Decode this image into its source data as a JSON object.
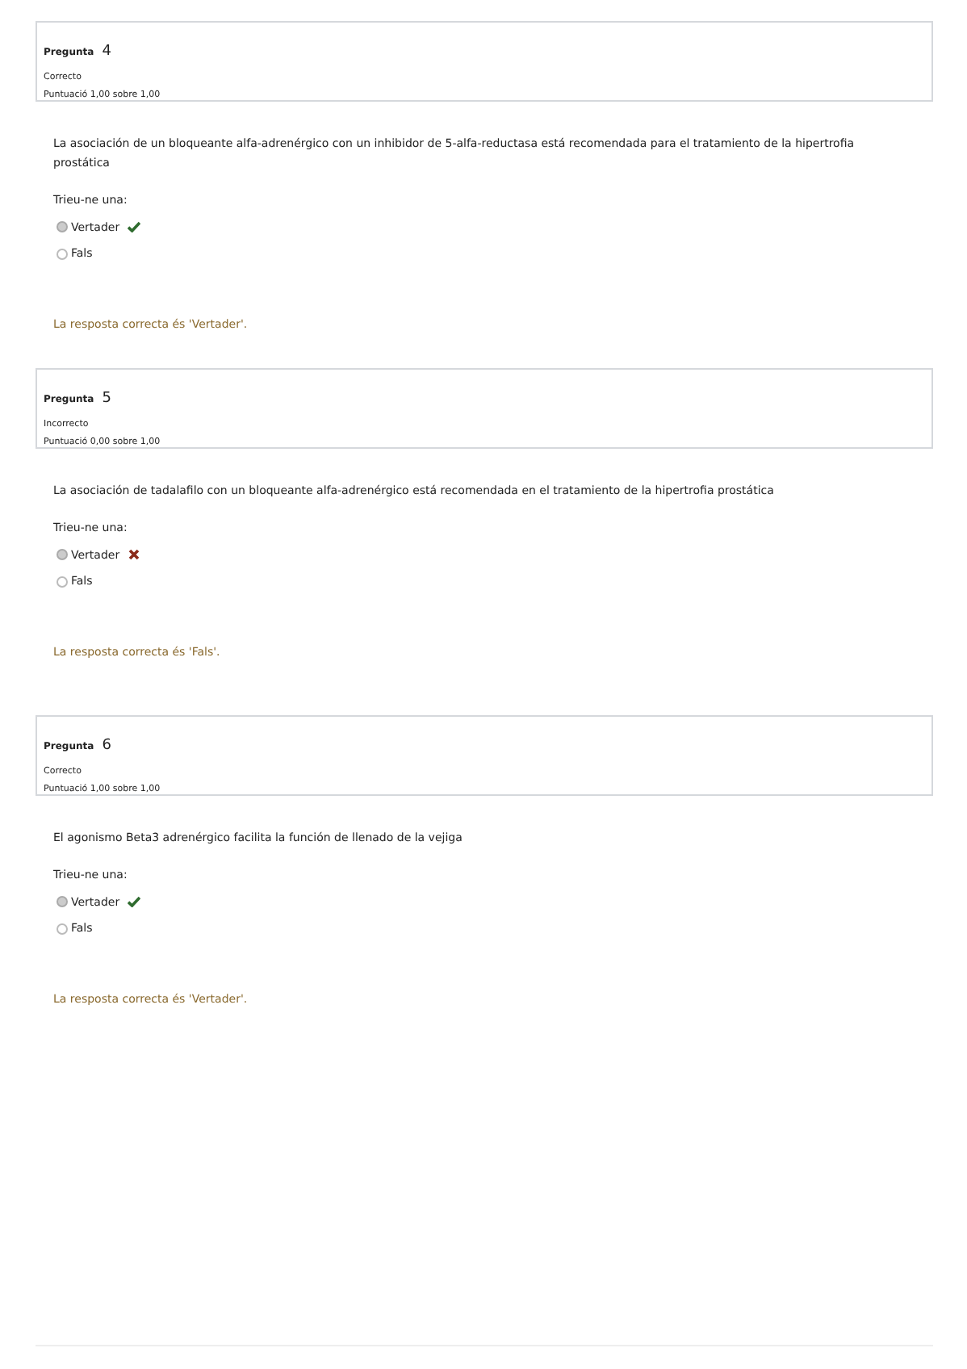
{
  "questions": [
    {
      "label": "Pregunta",
      "number": "4",
      "status": "Correcto",
      "score": "Puntuació 1,00 sobre 1,00",
      "text": "La asociación de un bloqueante alfa-adrenérgico con un inhibidor de 5-alfa-reductasa está recomendada para el tratamiento de la hipertrofia prostática",
      "prompt": "Trieu-ne una:",
      "options": [
        {
          "label": "Vertader",
          "selected": true,
          "correct": true
        },
        {
          "label": "Fals",
          "selected": false
        }
      ],
      "feedback": "La resposta correcta és 'Vertader'."
    },
    {
      "label": "Pregunta",
      "number": "5",
      "status": "Incorrecto",
      "score": "Puntuació 0,00 sobre 1,00",
      "text": "La asociación de tadalafilo con un bloqueante alfa-adrenérgico está recomendada en el tratamiento de la hipertrofia prostática",
      "prompt": "Trieu-ne una:",
      "options": [
        {
          "label": "Vertader",
          "selected": true,
          "correct": false
        },
        {
          "label": "Fals",
          "selected": false
        }
      ],
      "feedback": "La resposta correcta és 'Fals'."
    },
    {
      "label": "Pregunta",
      "number": "6",
      "status": "Correcto",
      "score": "Puntuació 1,00 sobre 1,00",
      "text": "El agonismo Beta3 adrenérgico facilita la función de llenado de la vejiga",
      "prompt": "Trieu-ne una:",
      "options": [
        {
          "label": "Vertader",
          "selected": true,
          "correct": true
        },
        {
          "label": "Fals",
          "selected": false
        }
      ],
      "feedback": "La resposta correcta és 'Vertader'."
    }
  ]
}
